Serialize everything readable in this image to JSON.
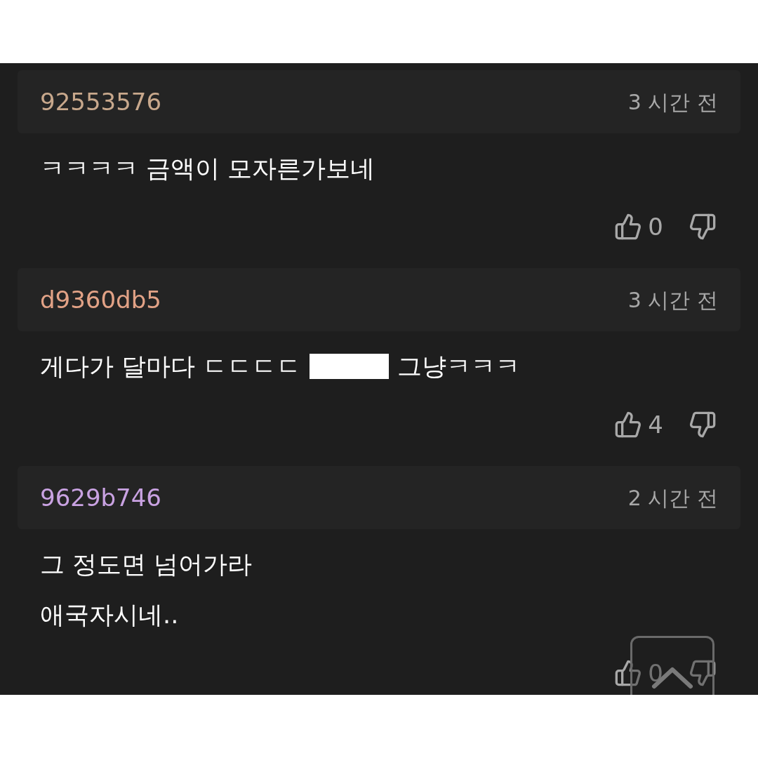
{
  "comments": [
    {
      "user": "92553576",
      "color": "#c8a88c",
      "time": "3 시간 전",
      "lines": [
        {
          "parts": [
            {
              "kind": "text",
              "text": "ㅋㅋㅋㅋ 금액이 모자른가보네"
            }
          ]
        }
      ],
      "likes": "0"
    },
    {
      "user": "d9360db5",
      "color": "#e2a286",
      "time": "3 시간 전",
      "lines": [
        {
          "parts": [
            {
              "kind": "text",
              "text": "게다가 달마다 ㄷㄷㄷㄷ"
            },
            {
              "kind": "redaction"
            },
            {
              "kind": "text",
              "text": "그냥ㅋㅋㅋ"
            }
          ]
        }
      ],
      "likes": "4"
    },
    {
      "user": "9629b746",
      "color": "#c9a2e2",
      "time": "2 시간 전",
      "lines": [
        {
          "parts": [
            {
              "kind": "text",
              "text": "그 정도면 넘어가라"
            }
          ]
        },
        {
          "parts": [
            {
              "kind": "text",
              "text": "애국자시네.."
            }
          ]
        }
      ],
      "likes": "0"
    }
  ]
}
